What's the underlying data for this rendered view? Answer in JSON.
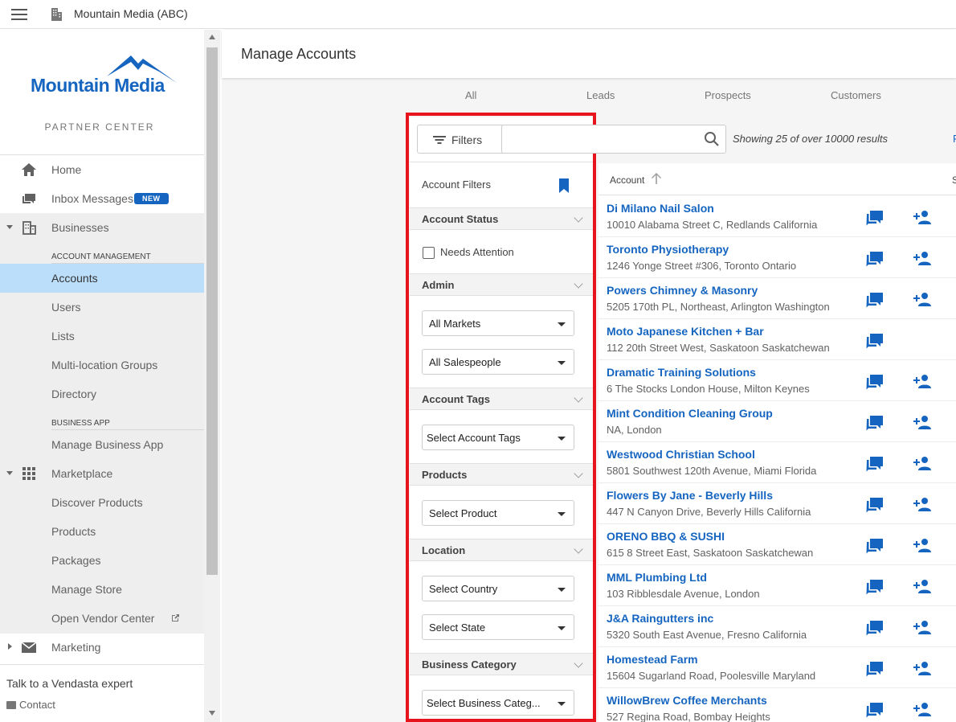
{
  "topbar": {
    "title": "Mountain Media (ABC)"
  },
  "sidebar": {
    "logo_text": "Mountain Media",
    "partner_center": "PARTNER CENTER",
    "home": "Home",
    "inbox": "Inbox Messages",
    "new_badge": "NEW",
    "businesses": "Businesses",
    "account_management": "ACCOUNT MANAGEMENT",
    "accounts": "Accounts",
    "users": "Users",
    "lists": "Lists",
    "multi_location": "Multi-location Groups",
    "directory": "Directory",
    "business_app_head": "BUSINESS APP",
    "manage_business_app": "Manage Business App",
    "marketplace": "Marketplace",
    "discover_products": "Discover Products",
    "products": "Products",
    "packages": "Packages",
    "manage_store": "Manage Store",
    "open_vendor_center": "Open Vendor Center",
    "marketing": "Marketing",
    "talk": "Talk to a Vendasta expert",
    "contact": "Contact"
  },
  "main": {
    "title": "Manage Accounts",
    "tabs": [
      "All",
      "Leads",
      "Prospects",
      "Customers"
    ],
    "results": "Showing 25 of over 10000 results",
    "partial_link": "F",
    "search_placeholder": ""
  },
  "filters": {
    "button": "Filters",
    "account_filters": "Account Filters",
    "account_status": "Account Status",
    "needs_attention": "Needs Attention",
    "admin": "Admin",
    "all_markets": "All Markets",
    "all_salespeople": "All Salespeople",
    "account_tags": "Account Tags",
    "select_account_tags": "Select Account Tags",
    "products": "Products",
    "select_product": "Select Product",
    "location": "Location",
    "select_country": "Select Country",
    "select_state": "Select State",
    "business_category": "Business Category",
    "select_business_category": "Select Business Categ..."
  },
  "table": {
    "col_account": "Account",
    "col_cut": "S",
    "rows": [
      {
        "name": "Di Milano Nail Salon",
        "address": "10010 Alabama Street C, Redlands California",
        "add_user": true
      },
      {
        "name": "Toronto Physiotherapy",
        "address": "1246 Yonge Street #306, Toronto Ontario",
        "add_user": true
      },
      {
        "name": "Powers Chimney & Masonry",
        "address": "5205 170th PL, Northeast, Arlington Washington",
        "add_user": true
      },
      {
        "name": "Moto Japanese Kitchen + Bar",
        "address": "112 20th Street West, Saskatoon Saskatchewan",
        "add_user": false
      },
      {
        "name": "Dramatic Training Solutions",
        "address": "6 The Stocks London House, Milton Keynes",
        "add_user": true
      },
      {
        "name": "Mint Condition Cleaning Group",
        "address": "NA, London",
        "add_user": true
      },
      {
        "name": "Westwood Christian School",
        "address": "5801 Southwest 120th Avenue, Miami Florida",
        "add_user": true
      },
      {
        "name": "Flowers By Jane - Beverly Hills",
        "address": "447 N Canyon Drive, Beverly Hills California",
        "add_user": true
      },
      {
        "name": "ORENO BBQ & SUSHI",
        "address": "615 8 Street East, Saskatoon Saskatchewan",
        "add_user": true
      },
      {
        "name": "MML Plumbing Ltd",
        "address": "103 Ribblesdale Avenue, London",
        "add_user": true
      },
      {
        "name": "J&A Raingutters inc",
        "address": "5320 South East Avenue, Fresno California",
        "add_user": true
      },
      {
        "name": "Homestead Farm",
        "address": "15604 Sugarland Road, Poolesville Maryland",
        "add_user": true
      },
      {
        "name": "WillowBrew Coffee Merchants",
        "address": "527 Regina Road, Bombay Heights",
        "add_user": true
      }
    ]
  },
  "colors": {
    "accent": "#1565c0",
    "highlight": "#bbdefb",
    "annotation": "#e8141d"
  }
}
